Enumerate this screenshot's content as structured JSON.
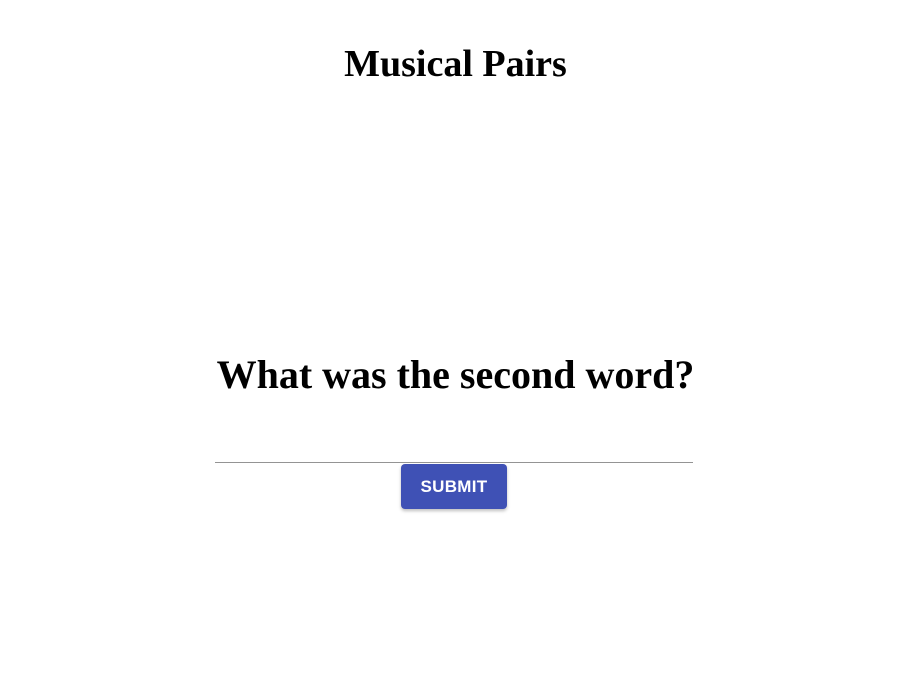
{
  "header": {
    "title": "Musical Pairs"
  },
  "quiz": {
    "question": "What was the second word?",
    "answer_value": "",
    "answer_placeholder": "",
    "submit_label": "SUBMIT"
  },
  "colors": {
    "accent": "#3f51b5",
    "input_underline": "#949494",
    "background": "#ffffff"
  }
}
